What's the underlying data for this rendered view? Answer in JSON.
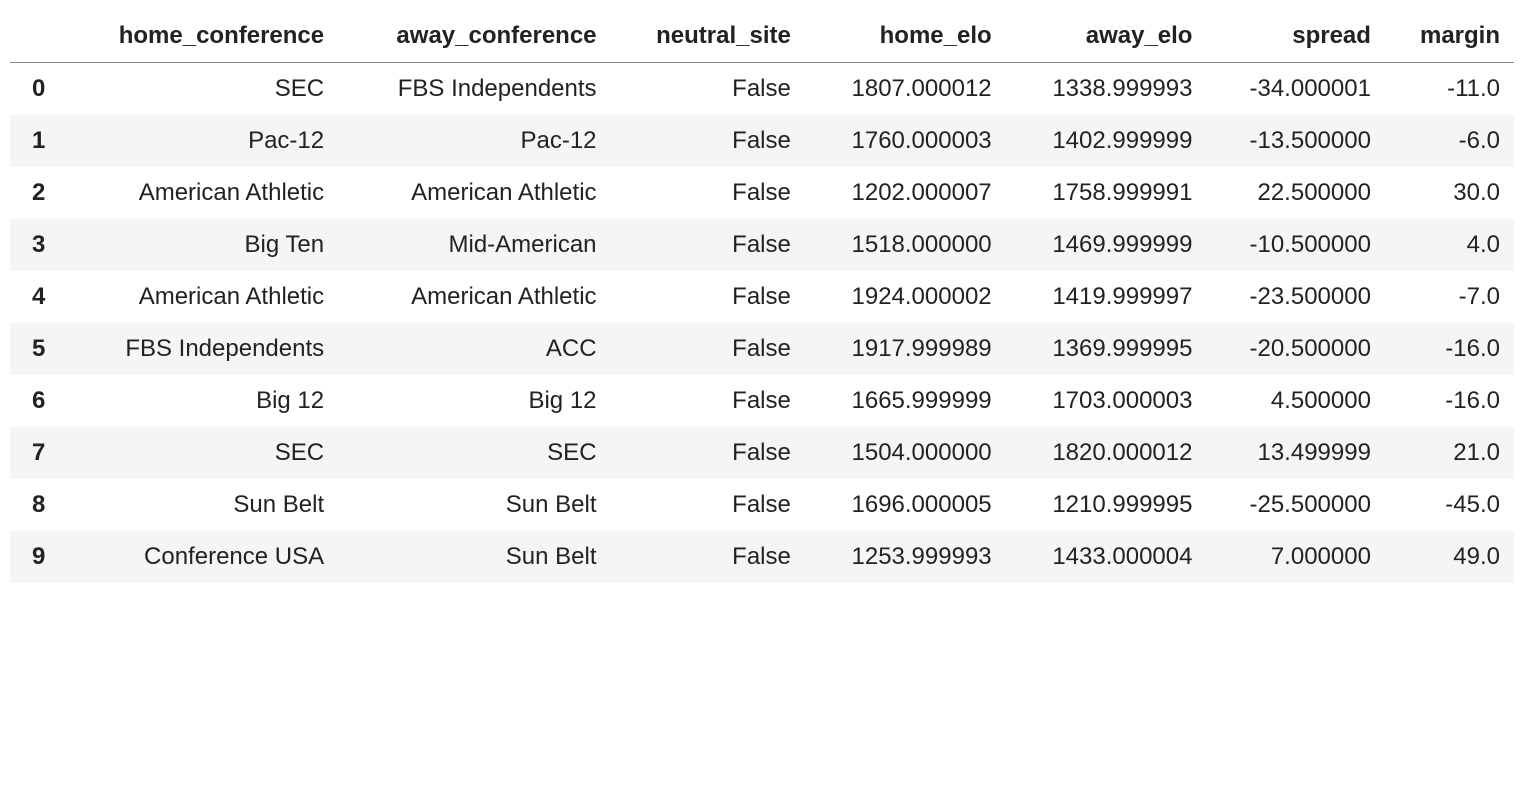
{
  "chart_data": {
    "type": "table",
    "columns": [
      "home_conference",
      "away_conference",
      "neutral_site",
      "home_elo",
      "away_elo",
      "spread",
      "margin"
    ],
    "index": [
      "0",
      "1",
      "2",
      "3",
      "4",
      "5",
      "6",
      "7",
      "8",
      "9"
    ],
    "rows": [
      [
        "SEC",
        "FBS Independents",
        "False",
        "1807.000012",
        "1338.999993",
        "-34.000001",
        "-11.0"
      ],
      [
        "Pac-12",
        "Pac-12",
        "False",
        "1760.000003",
        "1402.999999",
        "-13.500000",
        "-6.0"
      ],
      [
        "American Athletic",
        "American Athletic",
        "False",
        "1202.000007",
        "1758.999991",
        "22.500000",
        "30.0"
      ],
      [
        "Big Ten",
        "Mid-American",
        "False",
        "1518.000000",
        "1469.999999",
        "-10.500000",
        "4.0"
      ],
      [
        "American Athletic",
        "American Athletic",
        "False",
        "1924.000002",
        "1419.999997",
        "-23.500000",
        "-7.0"
      ],
      [
        "FBS Independents",
        "ACC",
        "False",
        "1917.999989",
        "1369.999995",
        "-20.500000",
        "-16.0"
      ],
      [
        "Big 12",
        "Big 12",
        "False",
        "1665.999999",
        "1703.000003",
        "4.500000",
        "-16.0"
      ],
      [
        "SEC",
        "SEC",
        "False",
        "1504.000000",
        "1820.000012",
        "13.499999",
        "21.0"
      ],
      [
        "Sun Belt",
        "Sun Belt",
        "False",
        "1696.000005",
        "1210.999995",
        "-25.500000",
        "-45.0"
      ],
      [
        "Conference USA",
        "Sun Belt",
        "False",
        "1253.999993",
        "1433.000004",
        "7.000000",
        "49.0"
      ]
    ]
  }
}
